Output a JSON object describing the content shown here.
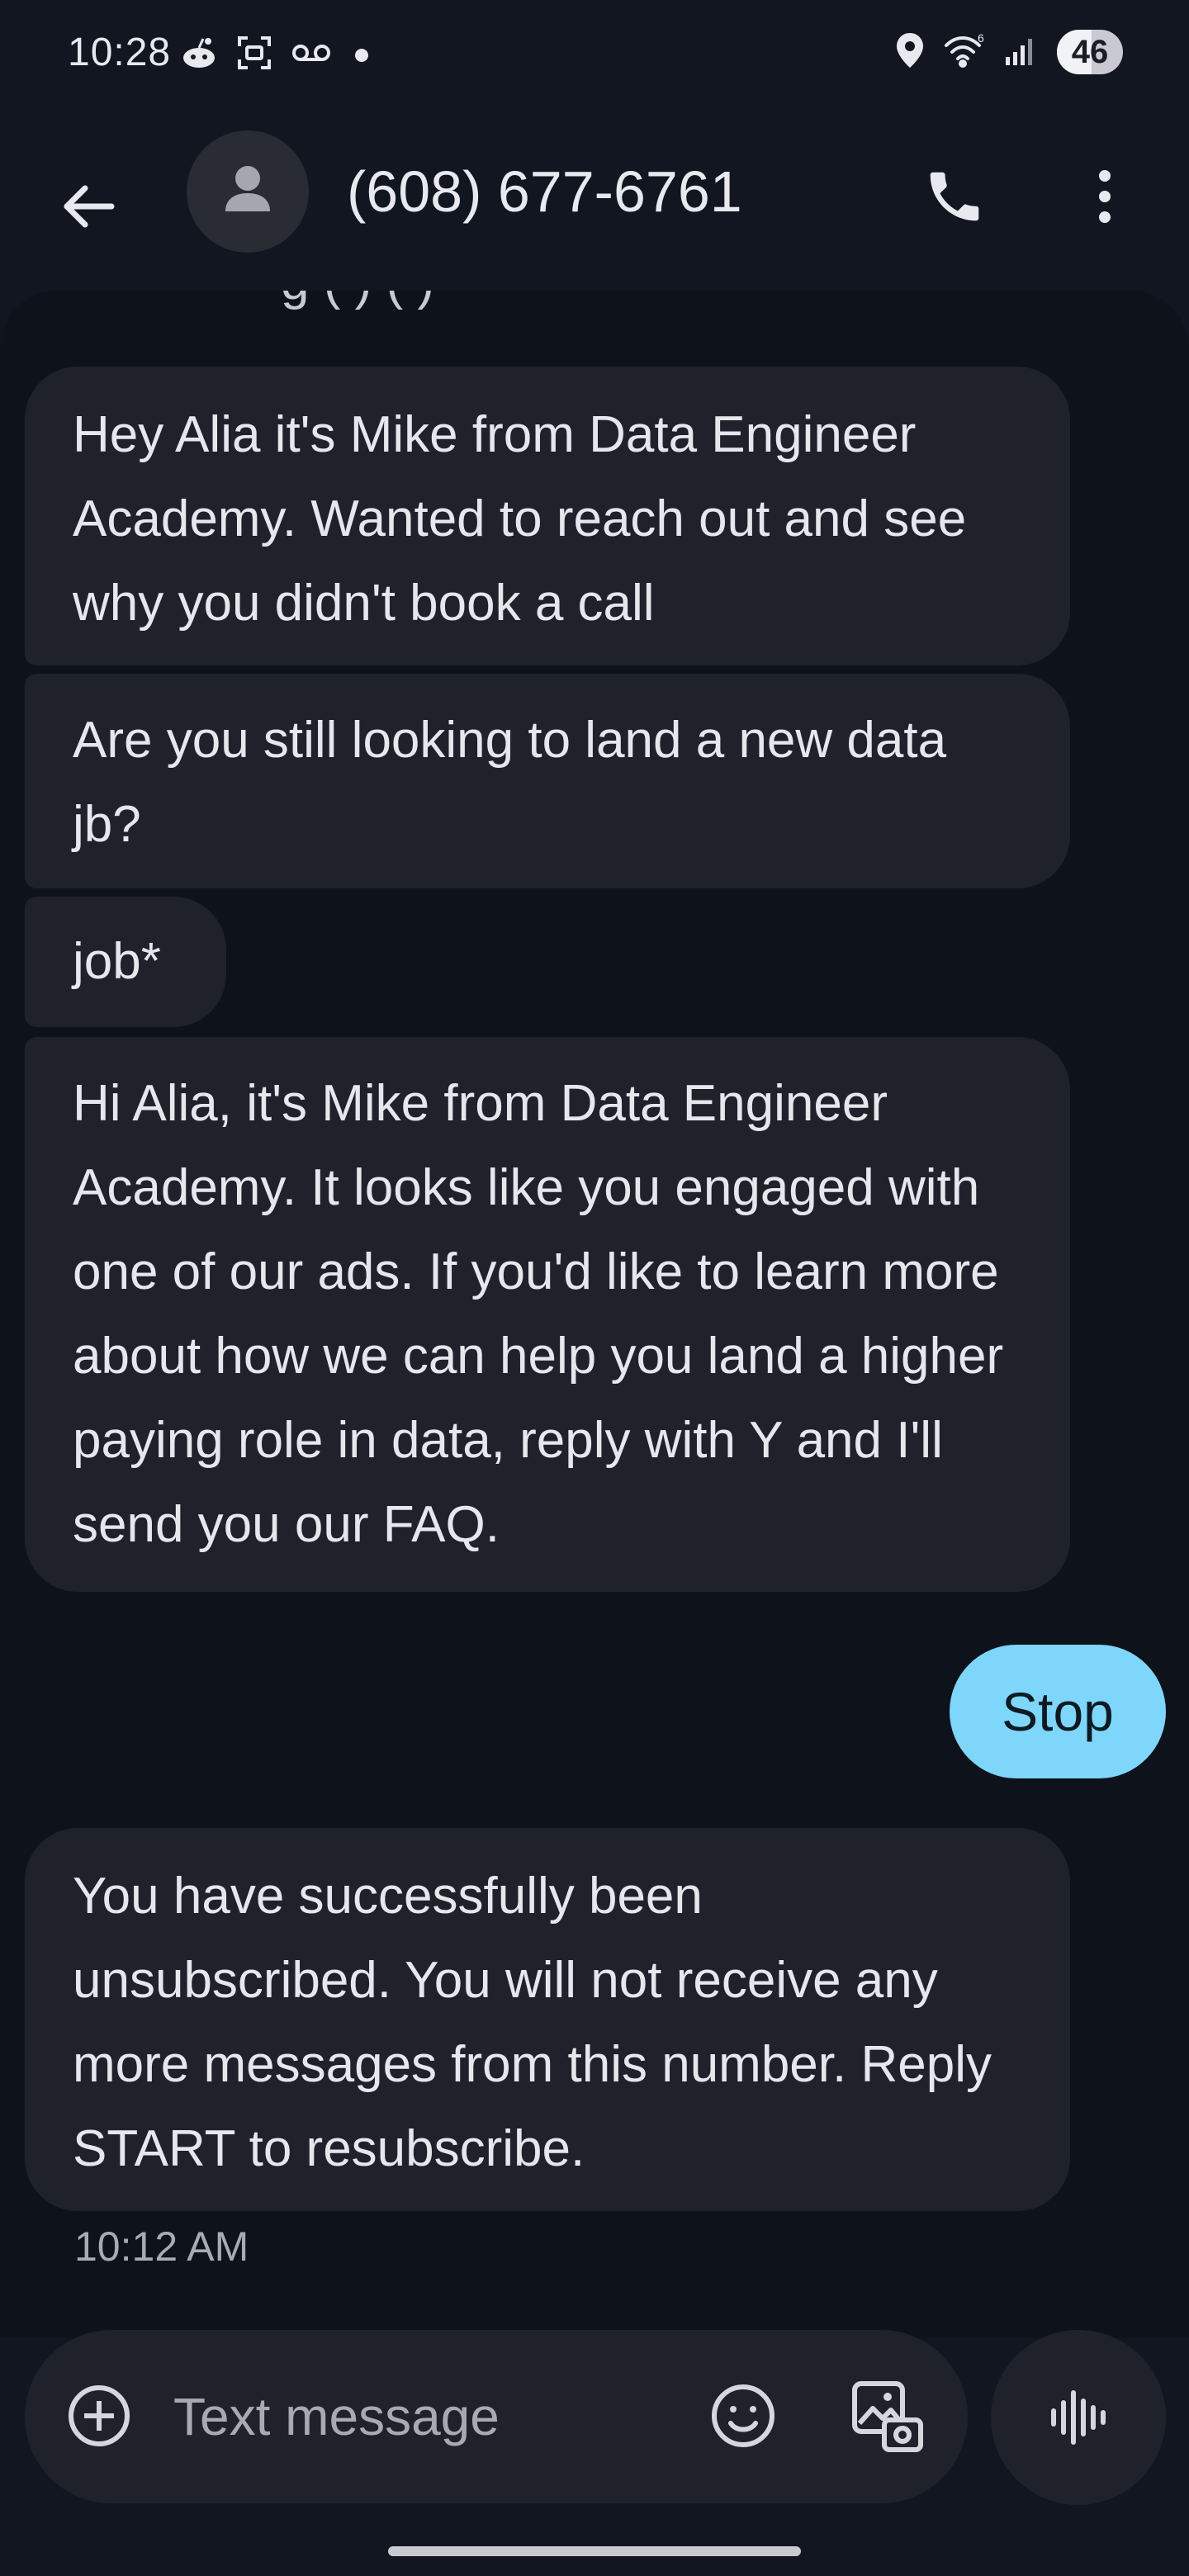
{
  "status_bar": {
    "time": "10:28",
    "battery": "46",
    "icons_left": [
      "reddit-icon",
      "screenshot-icon",
      "voicemail-icon",
      "notification-dot"
    ],
    "icons_right": [
      "location-icon",
      "wifi-icon",
      "signal-icon",
      "battery-icon"
    ]
  },
  "header": {
    "contact": "(608) 677-6761",
    "icons": [
      "back-arrow-icon",
      "avatar",
      "phone-icon",
      "more-vert-icon"
    ]
  },
  "thread": {
    "cut_off_text": "g     (   )        (         )",
    "messages": [
      {
        "direction": "incoming",
        "text": "Hey Alia it's Mike from Data Engineer Academy. Wanted to reach out and see why you didn't book a call"
      },
      {
        "direction": "incoming",
        "text": "Are you still looking to land a new data jb?"
      },
      {
        "direction": "incoming",
        "text": "job*"
      },
      {
        "direction": "incoming",
        "text": "Hi Alia, it's Mike from Data Engineer Academy. It looks like you engaged with one of our ads. If you'd like to learn more about how we can help you land a higher paying role in data, reply with Y and I'll send you our FAQ."
      },
      {
        "direction": "outgoing",
        "text": "Stop"
      },
      {
        "direction": "incoming",
        "text": "You have successfully been unsubscribed. You will not receive any more messages from this number. Reply START to resubscribe."
      }
    ],
    "timestamp": "10:12 AM"
  },
  "composer": {
    "placeholder": "Text message",
    "icons": [
      "add-icon",
      "emoji-icon",
      "gallery-icon",
      "voice-icon"
    ]
  },
  "colors": {
    "background": "#111620",
    "incoming_bubble": "#1f222b",
    "outgoing_bubble": "#7ed6fb"
  }
}
